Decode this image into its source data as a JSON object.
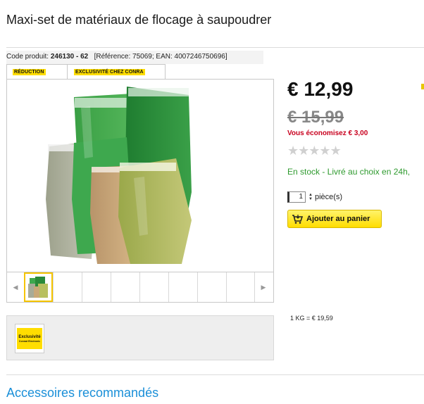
{
  "product": {
    "title": "Maxi-set de matériaux de flocage à saupoudrer",
    "code_label": "Code produit:",
    "code_value": "246130 - 62",
    "reference_text": "[Référence: 75069; EAN: 4007246750696]",
    "badges": [
      "RÉDUCTION",
      "EXCLUSIVITÉ CHEZ CONRA"
    ],
    "image_icon": "product-photo-flock-bags",
    "thumbnail_count": 8
  },
  "pricing": {
    "price": "€ 12,99",
    "old_price": "€ 15,99",
    "savings": "Vous économisez € 3,00",
    "rating_stars": "★★★★★",
    "rating_value": 0,
    "stock": "En stock - Livré au choix en 24h,",
    "quantity": "1",
    "quantity_unit": "pièce(s)",
    "add_to_cart": "Ajouter au panier",
    "unit_price": "1 KG = € 19,59"
  },
  "logo": {
    "line1": "Exclusivité",
    "line2": "Conrad Electronic"
  },
  "accessories": {
    "heading": "Accessoires recommandés"
  },
  "colors": {
    "accent_yellow": "#ffdd00",
    "savings_red": "#c8001e",
    "stock_green": "#2e9a2e",
    "link_blue": "#1a8fd8"
  }
}
